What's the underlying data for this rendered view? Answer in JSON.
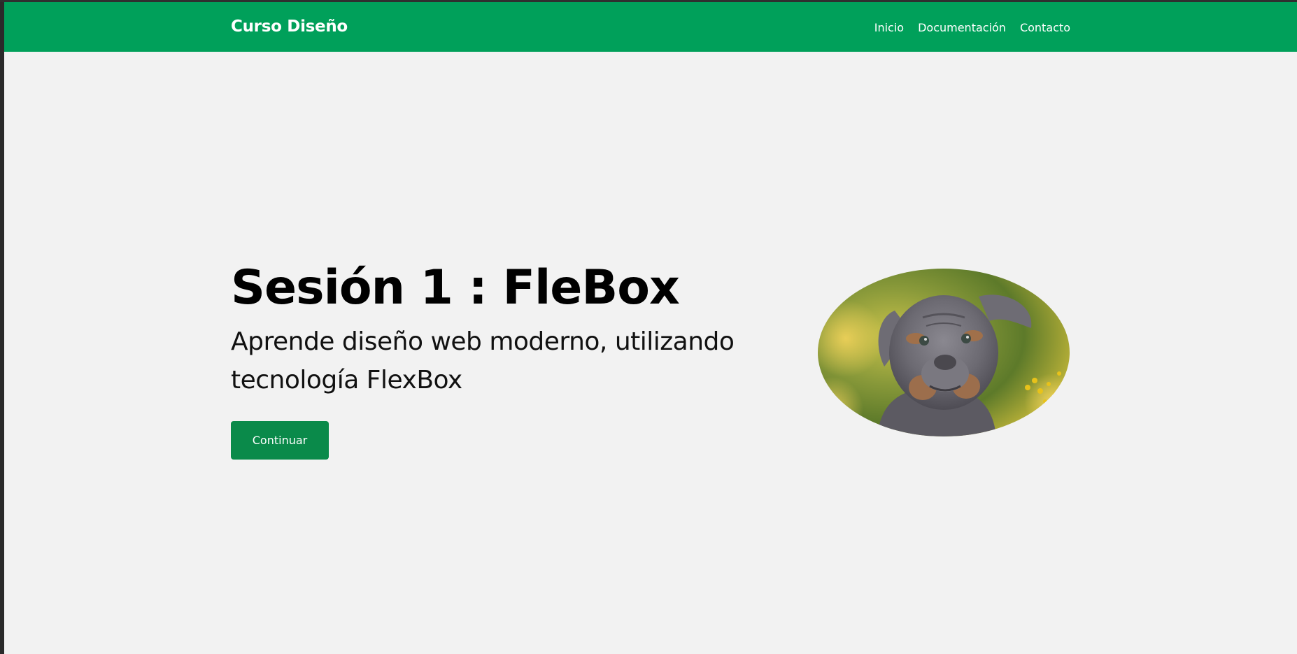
{
  "navbar": {
    "brand": "Curso Diseño",
    "links": [
      "Inicio",
      "Documentación",
      "Contacto"
    ],
    "color": "#00a05a"
  },
  "hero": {
    "title": "Sesión 1 : FleBox",
    "subtitle": "Aprende diseño web moderno, utilizando tecnología FlexBox",
    "button_label": "Continuar",
    "button_color": "#0a8a4a",
    "image": "puppy-photo"
  }
}
